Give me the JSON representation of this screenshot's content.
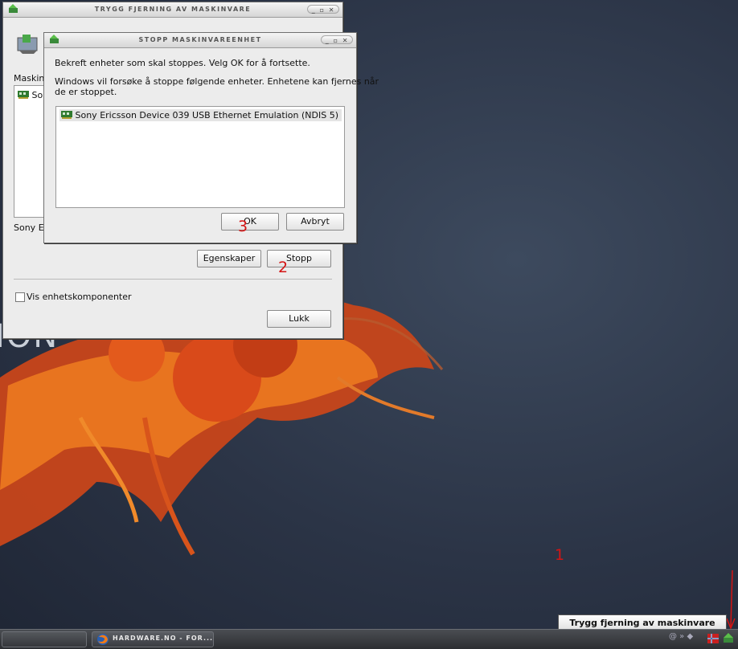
{
  "back_window": {
    "title": "TRYGG FJERNING AV MASKINVARE",
    "titlebar_controls": "_ ▫ ✕",
    "group_label": "Maskinv",
    "list_item": "So",
    "device_caption": "Sony Er",
    "properties_button": "Egenskaper",
    "stop_button": "Stopp",
    "show_components_label": "Vis enhetskomponenter",
    "close_button": "Lukk"
  },
  "front_window": {
    "title": "STOPP MASKINVAREENHET",
    "titlebar_controls": "_ ▫ ✕",
    "confirm_text": "Bekreft enheter som skal stoppes. Velg OK for å fortsette.",
    "info_line1": "Windows vil forsøke å stoppe følgende enheter. Enhetene kan fjernes når",
    "info_line2": "de er stoppet.",
    "device_item": "Sony Ericsson Device 039 USB Ethernet Emulation (NDIS 5)",
    "ok_button": "OK",
    "cancel_button": "Avbryt"
  },
  "annotations": {
    "one": "1",
    "two": "2",
    "three": "3"
  },
  "desktop": {
    "logo_fragment": "ION"
  },
  "taskbar": {
    "firefox_task": "HARDWARE.NO - FOR...",
    "tray_icons": "@ » ◆",
    "balloon_text": "Trygg fjerning av maskinvare"
  },
  "colors": {
    "annotation": "#d41414",
    "desktop": "#2b3446",
    "flame": "#e8601c"
  }
}
